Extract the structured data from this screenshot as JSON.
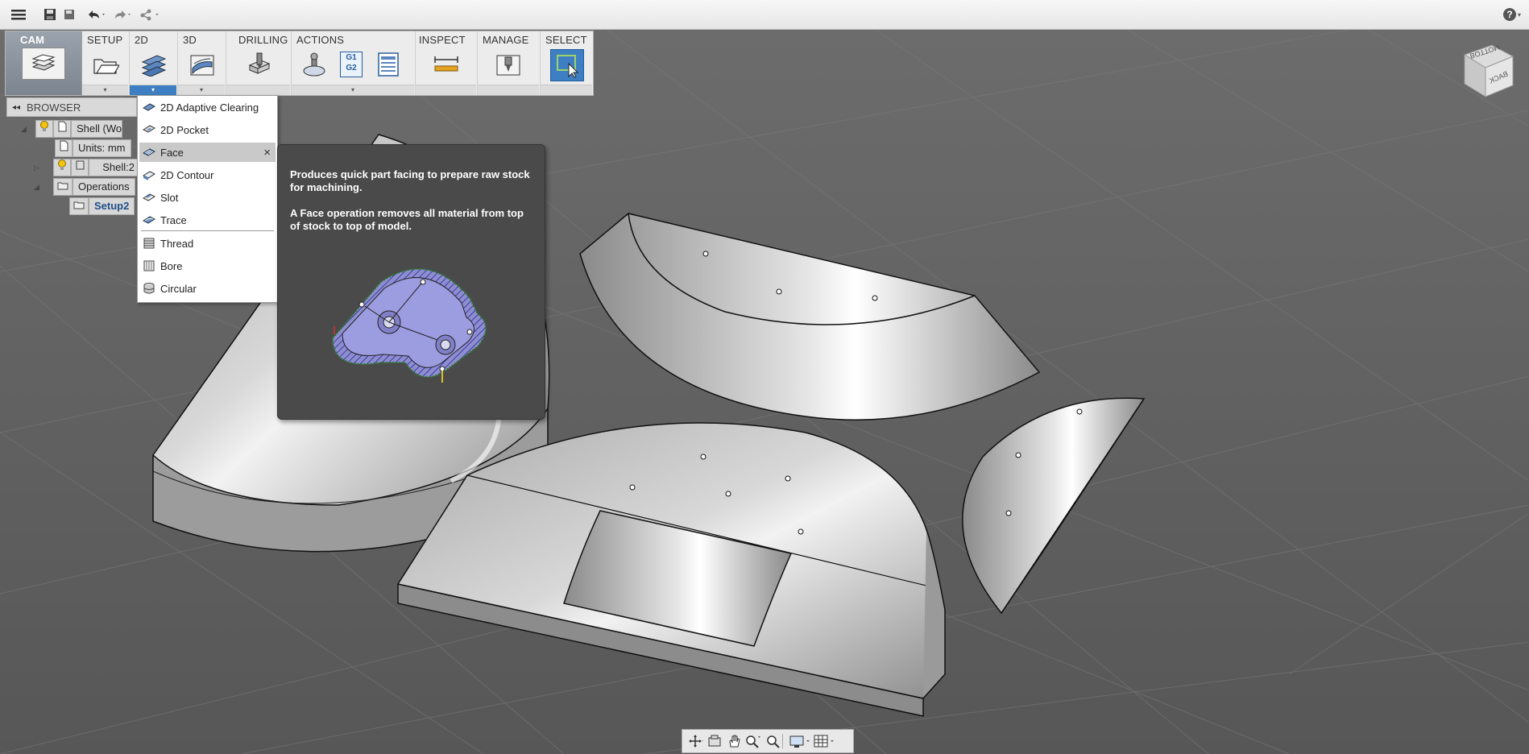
{
  "ribbon": {
    "workspace": "CAM",
    "groups": [
      "SETUP",
      "2D",
      "3D",
      "DRILLING",
      "ACTIONS",
      "INSPECT",
      "MANAGE",
      "SELECT"
    ],
    "actions_g1g2": "G1\nG2"
  },
  "browser": {
    "title": "BROWSER",
    "tree": {
      "shell": "Shell (Woo",
      "units": "Units: mm",
      "shell2": "Shell:2",
      "operations": "Operations",
      "setup": "Setup2"
    }
  },
  "menu_2d": {
    "items": [
      "2D Adaptive Clearing",
      "2D Pocket",
      "Face",
      "2D Contour",
      "Slot",
      "Trace",
      "Thread",
      "Bore",
      "Circular"
    ],
    "selected": "Face",
    "close_glyph": "×"
  },
  "tooltip": {
    "line1": "Produces quick part facing to prepare raw stock for machining.",
    "line2": "A Face operation removes all material from top of stock to top of model."
  },
  "viewcube": {
    "top": "BOTTOM",
    "front": "BACK"
  },
  "help_glyph": "?",
  "colors": {
    "viewport_bg": "#5e5e5e",
    "tooltip_bg": "#4a4a4a",
    "select_blue": "#3d7fc2",
    "menu_selected": "#c9c9c9"
  }
}
